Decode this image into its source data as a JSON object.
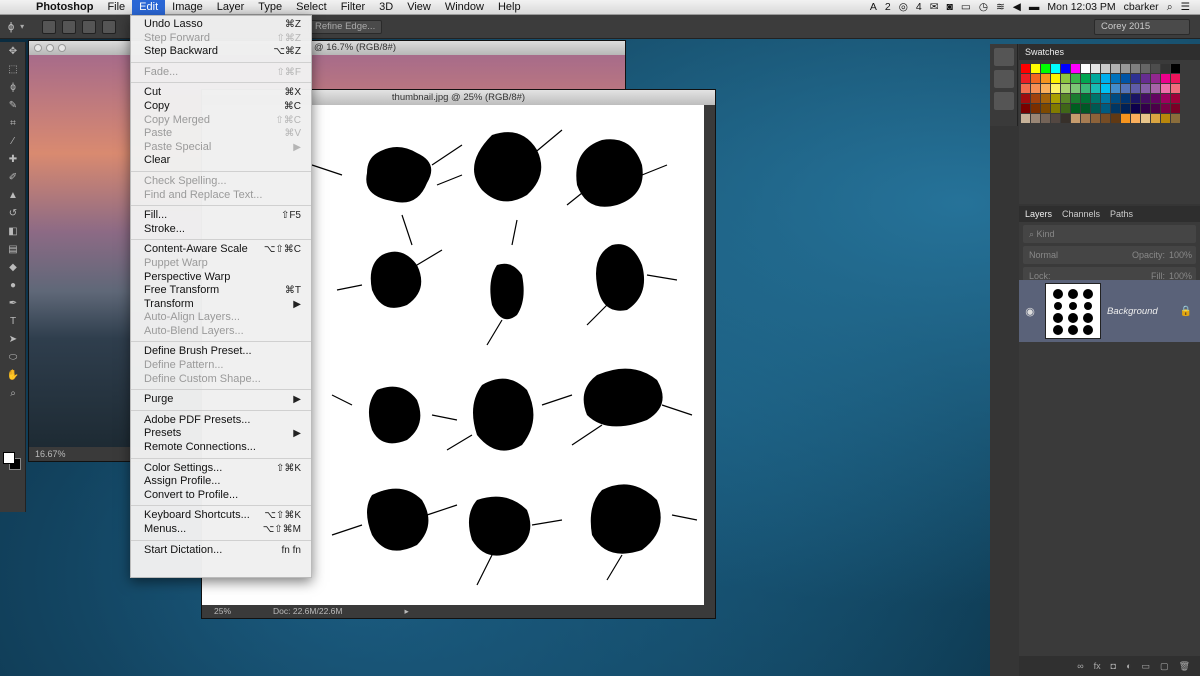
{
  "menubar": {
    "app_name": "Photoshop",
    "items": [
      "File",
      "Edit",
      "Image",
      "Layer",
      "Type",
      "Select",
      "Filter",
      "3D",
      "View",
      "Window",
      "Help"
    ],
    "clock": "Mon 12:03 PM",
    "user": "cbarker",
    "status_a": "2",
    "status_b": "4"
  },
  "options_bar": {
    "refine_edge_label": "Refine Edge...",
    "workspace": "Corey 2015"
  },
  "doc_back": {
    "title": "@ 16.7% (RGB/8#)",
    "zoom": "16.67%"
  },
  "doc_front": {
    "title": "thumbnail.jpg @ 25% (RGB/8#)",
    "zoom": "25%",
    "doc_size": "Doc: 22.6M/22.6M"
  },
  "edit_menu": {
    "undo": {
      "label": "Undo Lasso",
      "shortcut": "⌘Z"
    },
    "step_forward": {
      "label": "Step Forward",
      "shortcut": "⇧⌘Z"
    },
    "step_backward": {
      "label": "Step Backward",
      "shortcut": "⌥⌘Z"
    },
    "fade": {
      "label": "Fade...",
      "shortcut": "⇧⌘F"
    },
    "cut": {
      "label": "Cut",
      "shortcut": "⌘X"
    },
    "copy": {
      "label": "Copy",
      "shortcut": "⌘C"
    },
    "copy_merged": {
      "label": "Copy Merged",
      "shortcut": "⇧⌘C"
    },
    "paste": {
      "label": "Paste",
      "shortcut": "⌘V"
    },
    "paste_special": {
      "label": "Paste Special"
    },
    "clear": {
      "label": "Clear"
    },
    "check_spelling": {
      "label": "Check Spelling..."
    },
    "find_replace": {
      "label": "Find and Replace Text..."
    },
    "fill": {
      "label": "Fill...",
      "shortcut": "⇧F5"
    },
    "stroke": {
      "label": "Stroke..."
    },
    "content_aware_scale": {
      "label": "Content-Aware Scale",
      "shortcut": "⌥⇧⌘C"
    },
    "puppet_warp": {
      "label": "Puppet Warp"
    },
    "perspective_warp": {
      "label": "Perspective Warp"
    },
    "free_transform": {
      "label": "Free Transform",
      "shortcut": "⌘T"
    },
    "transform": {
      "label": "Transform"
    },
    "auto_align": {
      "label": "Auto-Align Layers..."
    },
    "auto_blend": {
      "label": "Auto-Blend Layers..."
    },
    "define_brush": {
      "label": "Define Brush Preset..."
    },
    "define_pattern": {
      "label": "Define Pattern..."
    },
    "define_shape": {
      "label": "Define Custom Shape..."
    },
    "purge": {
      "label": "Purge"
    },
    "pdf_presets": {
      "label": "Adobe PDF Presets..."
    },
    "presets": {
      "label": "Presets"
    },
    "remote_connections": {
      "label": "Remote Connections..."
    },
    "color_settings": {
      "label": "Color Settings...",
      "shortcut": "⇧⌘K"
    },
    "assign_profile": {
      "label": "Assign Profile..."
    },
    "convert_profile": {
      "label": "Convert to Profile..."
    },
    "keyboard_shortcuts": {
      "label": "Keyboard Shortcuts...",
      "shortcut": "⌥⇧⌘K"
    },
    "menus": {
      "label": "Menus...",
      "shortcut": "⌥⇧⌘M"
    },
    "dictation": {
      "label": "Start Dictation...",
      "shortcut": "fn fn"
    }
  },
  "panels": {
    "swatches_tab": "Swatches",
    "layers_tab": "Layers",
    "channels_tab": "Channels",
    "paths_tab": "Paths",
    "kind_label": "Kind",
    "blend_mode": "Normal",
    "opacity_label": "Opacity:",
    "opacity_value": "100%",
    "lock_label": "Lock:",
    "fill_label": "Fill:",
    "fill_value": "100%",
    "layer_name": "Background"
  },
  "colors": {
    "menu_highlight": "#2a67d6",
    "selected_layer": "#5a6279"
  }
}
